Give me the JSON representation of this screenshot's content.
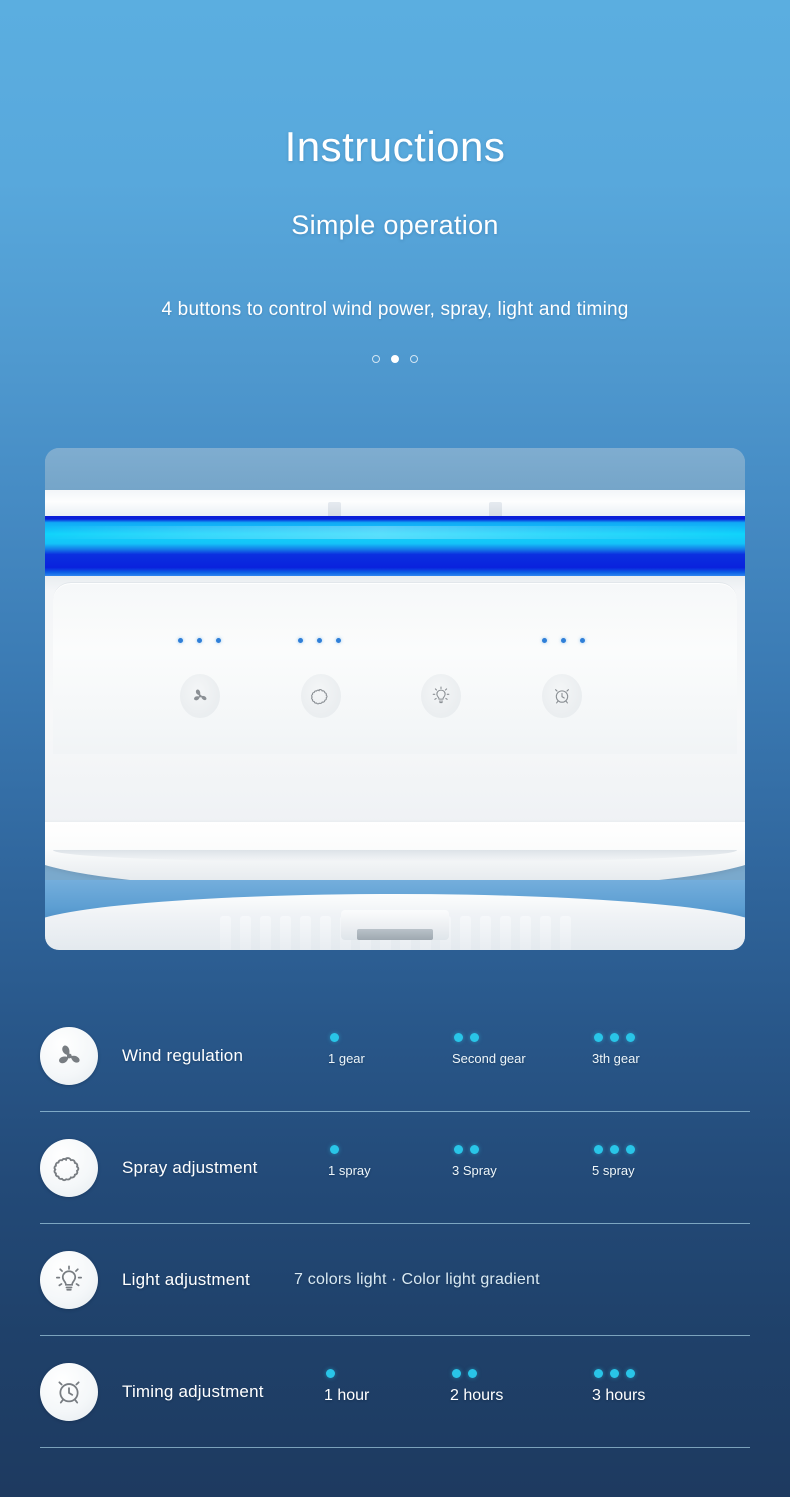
{
  "header": {
    "title": "Instructions",
    "subtitle": "Simple operation",
    "tagline": "4 buttons to control wind power, spray, light and timing",
    "pager": {
      "total": 3,
      "active_index": 1
    }
  },
  "product": {
    "panel_buttons": [
      {
        "icon": "fan-icon",
        "leds": 3
      },
      {
        "icon": "mist-icon",
        "leds": 3
      },
      {
        "icon": "bulb-icon",
        "leds": 0
      },
      {
        "icon": "alarm-clock-icon",
        "leds": 3
      }
    ],
    "nozzle_count": 5,
    "led_strip_colors": [
      "#0a1fd8",
      "#10d4fb",
      "#0b2fe0"
    ]
  },
  "features": [
    {
      "icon": "fan-icon",
      "label": "Wind regulation",
      "levels": [
        {
          "dots": 1,
          "text": "1 gear"
        },
        {
          "dots": 2,
          "text": "Second gear"
        },
        {
          "dots": 3,
          "text": "3th gear"
        }
      ]
    },
    {
      "icon": "mist-icon",
      "label": "Spray adjustment",
      "levels": [
        {
          "dots": 1,
          "text": "1 spray"
        },
        {
          "dots": 2,
          "text": "3 Spray"
        },
        {
          "dots": 3,
          "text": "5 spray"
        }
      ]
    },
    {
      "icon": "bulb-icon",
      "label": "Light adjustment",
      "note": "7 colors light · Color light gradient",
      "levels": []
    },
    {
      "icon": "alarm-clock-icon",
      "label": "Timing adjustment",
      "levels": [
        {
          "dots": 1,
          "text": "1 hour"
        },
        {
          "dots": 2,
          "text": "2 hours"
        },
        {
          "dots": 3,
          "text": "3 hours"
        }
      ]
    }
  ],
  "colors": {
    "bg_top": "#5BAEE0",
    "bg_bottom": "#1E3A60",
    "accent_cyan": "#29C5E8",
    "panel_led_blue": "#2F7FD8",
    "divider": "#B4E1F0"
  }
}
